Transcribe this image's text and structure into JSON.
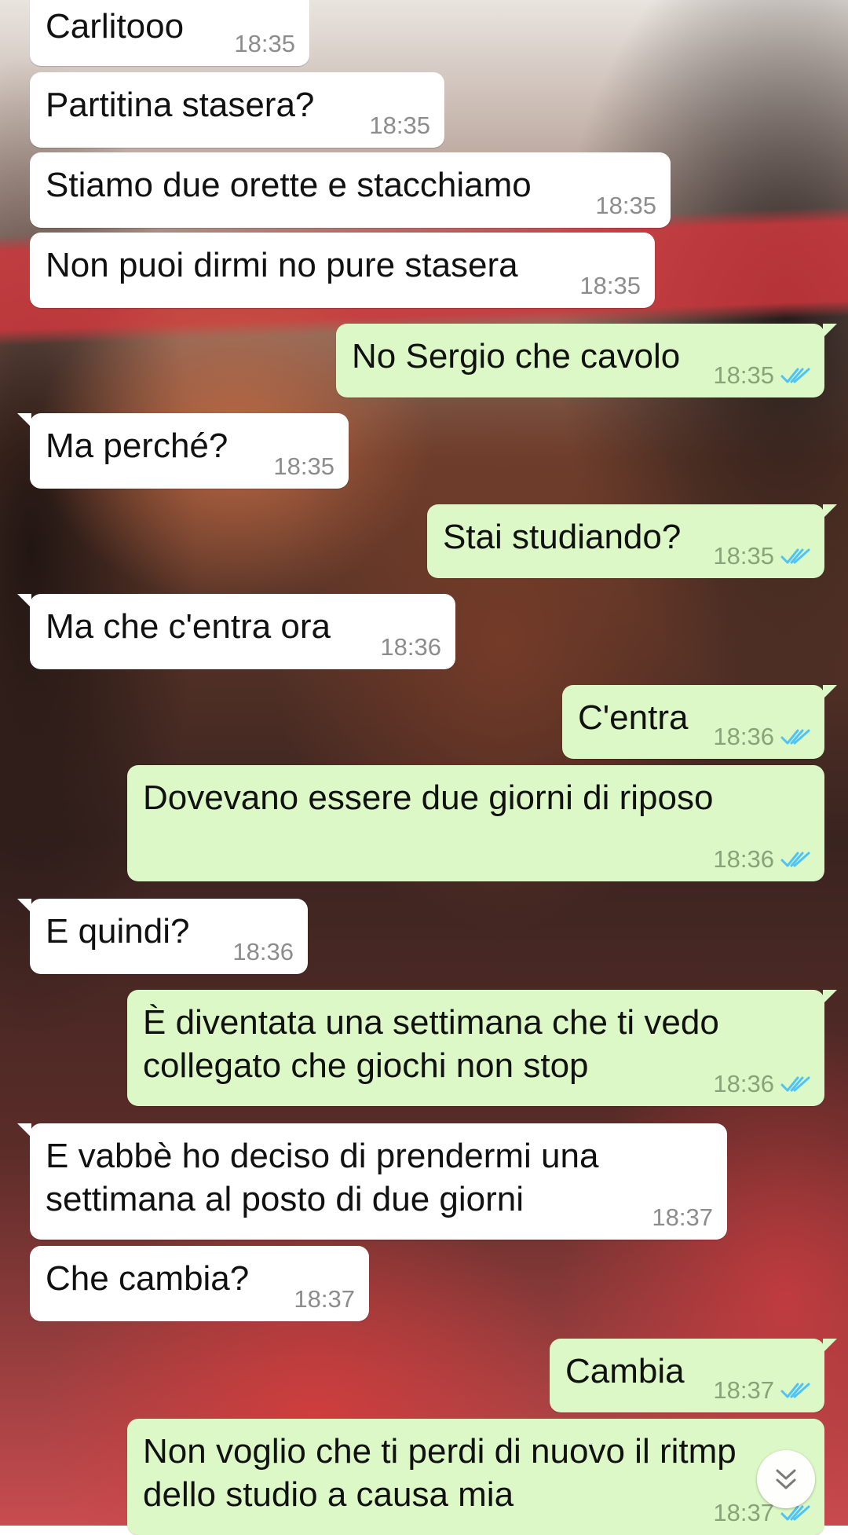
{
  "chat": {
    "messages": [
      {
        "direction": "incoming",
        "text": "Carlitooo",
        "time": "18:35"
      },
      {
        "direction": "incoming",
        "text": "Partitina stasera?",
        "time": "18:35"
      },
      {
        "direction": "incoming",
        "text": "Stiamo due orette e stacchiamo",
        "time": "18:35"
      },
      {
        "direction": "incoming",
        "text": "Non puoi dirmi no pure stasera",
        "time": "18:35"
      },
      {
        "direction": "outgoing",
        "text": "No Sergio che cavolo",
        "time": "18:35",
        "status": "read"
      },
      {
        "direction": "incoming",
        "text": "Ma perché?",
        "time": "18:35"
      },
      {
        "direction": "outgoing",
        "text": "Stai studiando?",
        "time": "18:35",
        "status": "read"
      },
      {
        "direction": "incoming",
        "text": "Ma che c'entra ora",
        "time": "18:36"
      },
      {
        "direction": "outgoing",
        "text": "C'entra",
        "time": "18:36",
        "status": "read"
      },
      {
        "direction": "outgoing",
        "text": "Dovevano essere due giorni di riposo",
        "time": "18:36",
        "status": "read"
      },
      {
        "direction": "incoming",
        "text": "E quindi?",
        "time": "18:36"
      },
      {
        "direction": "outgoing",
        "text": "È diventata una settimana che ti vedo\ncollegato che giochi non stop",
        "time": "18:36",
        "status": "read"
      },
      {
        "direction": "incoming",
        "text": "E vabbè ho deciso di prendermi una\nsettimana al posto di due giorni",
        "time": "18:37"
      },
      {
        "direction": "incoming",
        "text": "Che cambia?",
        "time": "18:37"
      },
      {
        "direction": "outgoing",
        "text": "Cambia",
        "time": "18:37",
        "status": "read"
      },
      {
        "direction": "outgoing",
        "text": "Non voglio che ti perdi di nuovo il ritmp\ndello studio a causa mia",
        "time": "18:37",
        "status": "read"
      }
    ]
  },
  "colors": {
    "incoming_bubble": "#ffffff",
    "outgoing_bubble": "#dcf8c6",
    "read_ticks": "#4fc3f7",
    "timestamp": "#8c8c8c"
  },
  "icons": {
    "read_status": "double-check-icon",
    "scroll_down": "double-chevron-down-icon"
  }
}
